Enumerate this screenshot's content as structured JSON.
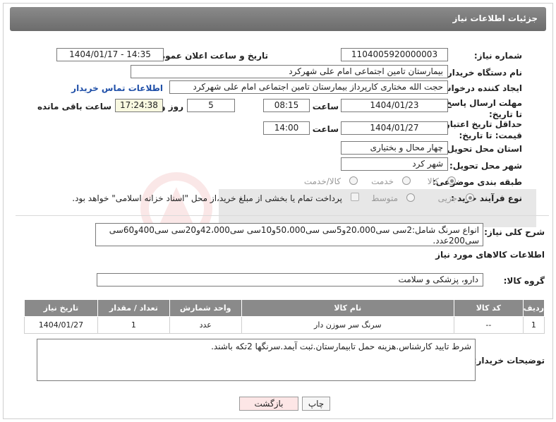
{
  "header": {
    "title": "جزئیات اطلاعات نیاز"
  },
  "form": {
    "need_number_label": "شماره نیاز:",
    "need_number": "1104005920000003",
    "announce_label": "تاریخ و ساعت اعلان عمومی:",
    "announce_value": "1404/01/17 - 14:35",
    "buyer_label": "نام دستگاه خریدار:",
    "buyer_value": "بیمارستان تامین اجتماعی امام علی شهرکرد",
    "creator_label": "ایجاد کننده درخواست:",
    "creator_value": "حجت الله مختاری کارپرداز بیمارستان تامین اجتماعی امام علی شهرکرد",
    "contact_link": "اطلاعات تماس خریدار",
    "deadline_label": "مهلت ارسال پاسخ: تا تاریخ:",
    "deadline_date": "1404/01/23",
    "time_label": "ساعت",
    "deadline_time": "08:15",
    "days_value": "5",
    "days_label": "روز و",
    "remaining_time": "17:24:38",
    "remaining_label": "ساعت باقی مانده",
    "price_label": "حداقل تاریخ اعتبار قیمت: تا تاریخ:",
    "price_date": "1404/01/27",
    "price_time": "14:00",
    "province_label": "استان محل تحویل:",
    "province_value": "چهار محال و بختیاری",
    "city_label": "شهر محل تحویل:",
    "city_value": "شهر کرد",
    "category_label": "طبقه بندی موضوعی:",
    "category_options": [
      "کالا",
      "خدمت",
      "کالا/خدمت"
    ],
    "process_label": "نوع فرآیند خرید :",
    "process_options": [
      "جزیی",
      "متوسط"
    ],
    "treasury_note": "پرداخت تمام یا بخشی از مبلغ خرید،از محل \"اسناد خزانه اسلامی\" خواهد بود."
  },
  "description": {
    "label": "شرح کلی نیاز:",
    "text": "انواع سرنگ شامل:2سی سی20،000و5سی سی50،000و10سی سی42،000و20سی سی400و60سی سی200عدد."
  },
  "goods": {
    "section_title": "اطلاعات کالاهای مورد نیاز",
    "group_label": "گروه کالا:",
    "group_value": "دارو، پزشکی و سلامت",
    "columns": [
      "ردیف",
      "کد کالا",
      "نام کالا",
      "واحد شمارش",
      "تعداد / مقدار",
      "تاریخ نیاز"
    ],
    "rows": [
      {
        "row": "1",
        "code": "--",
        "name": "سرنگ سر سوزن دار",
        "unit": "عدد",
        "qty": "1",
        "date": "1404/01/27"
      }
    ]
  },
  "notes": {
    "label": "توضیحات خریدار:",
    "text": "شرط تایید کارشناس.هزینه حمل تابیمارستان.ثبت آیمد.سرنگها 2تکه باشند."
  },
  "buttons": {
    "print": "چاپ",
    "back": "بازگشت"
  },
  "colors": {
    "header_bg": "#7b7b7b",
    "link": "#1f4fa8",
    "back_button_bg": "#fde6e6"
  }
}
